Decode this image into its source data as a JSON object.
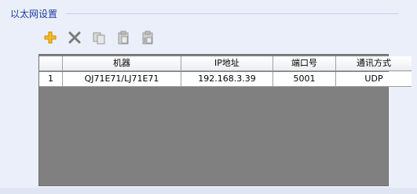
{
  "group_title": "以太网设置",
  "toolbar": {
    "buttons": [
      {
        "name": "add",
        "icon": "plus-icon",
        "enabled": true
      },
      {
        "name": "delete",
        "icon": "close-x-icon",
        "enabled": true
      },
      {
        "name": "copy",
        "icon": "copy-icon",
        "enabled": false
      },
      {
        "name": "paste",
        "icon": "paste-icon",
        "enabled": false
      },
      {
        "name": "paste-insert",
        "icon": "paste-insert-icon",
        "enabled": false
      }
    ]
  },
  "table": {
    "columns": [
      "",
      "机器",
      "IP地址",
      "端口号",
      "通讯方式"
    ],
    "rows": [
      {
        "index": "1",
        "machine": "QJ71E71/LJ71E71",
        "ip": "192.168.3.39",
        "port": "5001",
        "protocol": "UDP"
      }
    ]
  },
  "colors": {
    "background": "#ebeff9",
    "title": "#1c3a9e",
    "grid_empty": "#808080",
    "add_icon": "#f0b400"
  }
}
